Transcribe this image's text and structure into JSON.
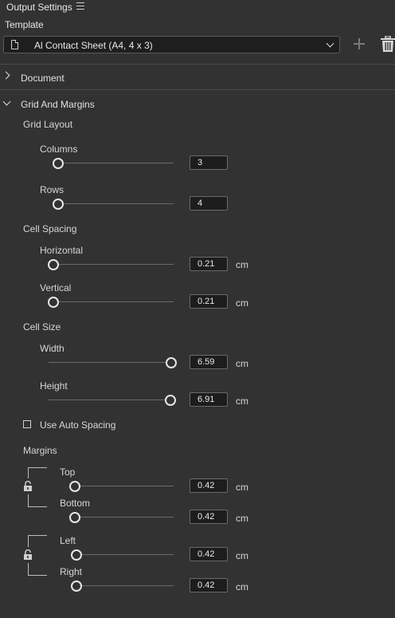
{
  "panel": {
    "title": "Output Settings",
    "menu_icon": "hamburger-menu-icon"
  },
  "template": {
    "label": "Template",
    "selected": "Al Contact Sheet (A4, 4 x 3)",
    "add_icon": "plus-icon",
    "delete_icon": "trash-icon",
    "doc_icon": "document-icon"
  },
  "sections": {
    "document": {
      "label": "Document",
      "expanded": false
    },
    "grid_margins": {
      "label": "Grid And Margins",
      "expanded": true
    }
  },
  "grid_layout": {
    "title": "Grid Layout",
    "columns": {
      "label": "Columns",
      "value": "3",
      "level": 0.0
    },
    "rows": {
      "label": "Rows",
      "value": "4",
      "level": 0.0
    }
  },
  "cell_spacing": {
    "title": "Cell Spacing",
    "horizontal": {
      "label": "Horizontal",
      "value": "0.21",
      "unit": "cm",
      "level": 0.0
    },
    "vertical": {
      "label": "Vertical",
      "value": "0.21",
      "unit": "cm",
      "level": 0.0
    }
  },
  "cell_size": {
    "title": "Cell Size",
    "width": {
      "label": "Width",
      "value": "6.59",
      "unit": "cm",
      "level": 1.0
    },
    "height": {
      "label": "Height",
      "value": "6.91",
      "unit": "cm",
      "level": 1.0
    }
  },
  "auto_spacing": {
    "label": "Use Auto Spacing",
    "checked": false
  },
  "margins": {
    "title": "Margins",
    "top": {
      "label": "Top",
      "value": "0.42",
      "unit": "cm",
      "level": 0.0
    },
    "bottom": {
      "label": "Bottom",
      "value": "0.42",
      "unit": "cm",
      "level": 0.0
    },
    "left": {
      "label": "Left",
      "value": "0.42",
      "unit": "cm",
      "level": 0.0
    },
    "right": {
      "label": "Right",
      "value": "0.42",
      "unit": "cm",
      "level": 0.0
    },
    "lock_icon": "unlocked-lock-icon"
  }
}
